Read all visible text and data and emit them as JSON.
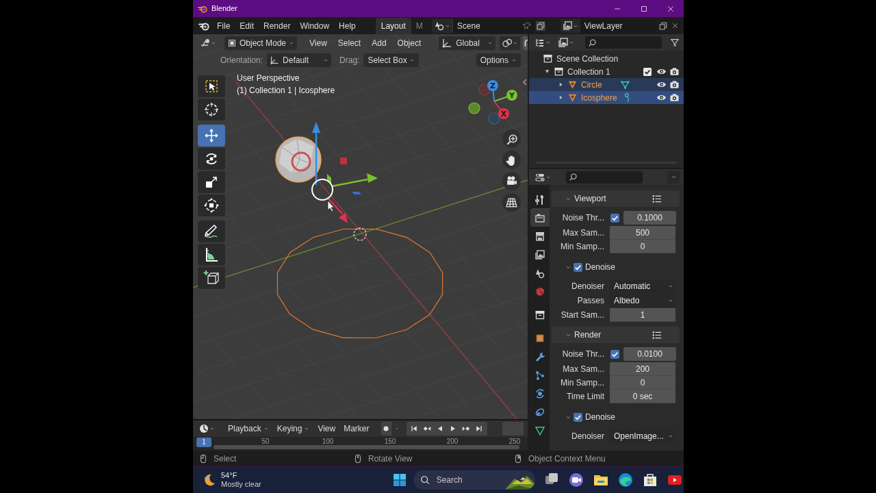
{
  "window": {
    "title": "Blender"
  },
  "topbar": {
    "menus": [
      "File",
      "Edit",
      "Render",
      "Window",
      "Help"
    ],
    "workspaces": [
      {
        "label": "Layout",
        "selected": true
      },
      {
        "label": "M",
        "selected": false
      }
    ],
    "scene": "Scene",
    "view_layer": "ViewLayer"
  },
  "viewport": {
    "header": {
      "mode": "Object Mode",
      "menus": [
        "View",
        "Select",
        "Add",
        "Object"
      ],
      "orientation": "Global"
    },
    "tool_settings": {
      "orientation_label": "Orientation:",
      "orientation": "Default",
      "drag_label": "Drag:",
      "drag": "Select Box",
      "options": "Options"
    },
    "overlay_text": [
      "User Perspective",
      "(1) Collection 1 | Icosphere"
    ],
    "tools": [
      {
        "selected": false
      },
      {
        "selected": false
      },
      {
        "selected": true
      },
      {
        "selected": false
      },
      {
        "selected": false
      },
      {
        "selected": false
      },
      {
        "selected": false
      },
      {
        "selected": false
      },
      {
        "selected": false
      }
    ],
    "gizmo_axes": [
      "X",
      "Y",
      "Z"
    ]
  },
  "timeline": {
    "menus": [
      {
        "label": "Playback",
        "dropdown": true
      },
      {
        "label": "Keying",
        "dropdown": true
      },
      {
        "label": "View",
        "dropdown": false
      },
      {
        "label": "Marker",
        "dropdown": false
      }
    ],
    "current_frame": "1",
    "ruler": [
      "50",
      "100",
      "150",
      "200",
      "250"
    ]
  },
  "outliner": {
    "items": [
      {
        "name": "Scene Collection",
        "children": [
          {
            "name": "Collection 1",
            "expanded": true,
            "checked": true,
            "children": [
              {
                "name": "Circle",
                "expanded": false,
                "selected": true,
                "active": false
              },
              {
                "name": "Icosphere",
                "expanded": false,
                "selected": true,
                "active": true
              }
            ]
          }
        ]
      }
    ]
  },
  "properties": {
    "tabs": [
      {
        "selected": false
      },
      {
        "selected": true
      },
      {
        "selected": false
      },
      {
        "selected": false
      },
      {
        "selected": false
      },
      {
        "selected": false
      },
      {
        "selected": false
      },
      {
        "selected": false
      },
      {
        "selected": false
      },
      {
        "selected": false
      },
      {
        "selected": false
      },
      {
        "selected": false
      },
      {
        "selected": false
      }
    ],
    "rows": [
      {
        "kind": "panel",
        "label": "Viewport",
        "expanded": true
      },
      {
        "kind": "toggle_value",
        "label": "Noise Thr...",
        "checked": true,
        "value": "0.1000"
      },
      {
        "kind": "number",
        "label": "Max Sam...",
        "value": "500"
      },
      {
        "kind": "number",
        "label": "Min Samp...",
        "value": "0"
      },
      {
        "kind": "subpanel",
        "label": "Denoise",
        "expanded": true,
        "checked": true
      },
      {
        "kind": "dropdown",
        "label": "Denoiser",
        "value": "Automatic"
      },
      {
        "kind": "dropdown",
        "label": "Passes",
        "value": "Albedo"
      },
      {
        "kind": "number",
        "label": "Start Sam...",
        "value": "1"
      },
      {
        "kind": "panel",
        "label": "Render",
        "expanded": true
      },
      {
        "kind": "toggle_value",
        "label": "Noise Thr...",
        "checked": true,
        "value": "0.0100"
      },
      {
        "kind": "number",
        "label": "Max Sam...",
        "value": "200"
      },
      {
        "kind": "number",
        "label": "Min Samp...",
        "value": "0"
      },
      {
        "kind": "number",
        "label": "Time Limit",
        "value": "0 sec"
      },
      {
        "kind": "subpanel",
        "label": "Denoise",
        "expanded": true,
        "checked": true
      },
      {
        "kind": "dropdown",
        "label": "Denoiser",
        "value": "OpenImage..."
      }
    ]
  },
  "status_bar": [
    "Select",
    "Rotate View",
    "Object Context Menu"
  ],
  "taskbar": {
    "temperature": "54°F",
    "weather": "Mostly clear",
    "search": {
      "placeholder": "Search"
    }
  }
}
